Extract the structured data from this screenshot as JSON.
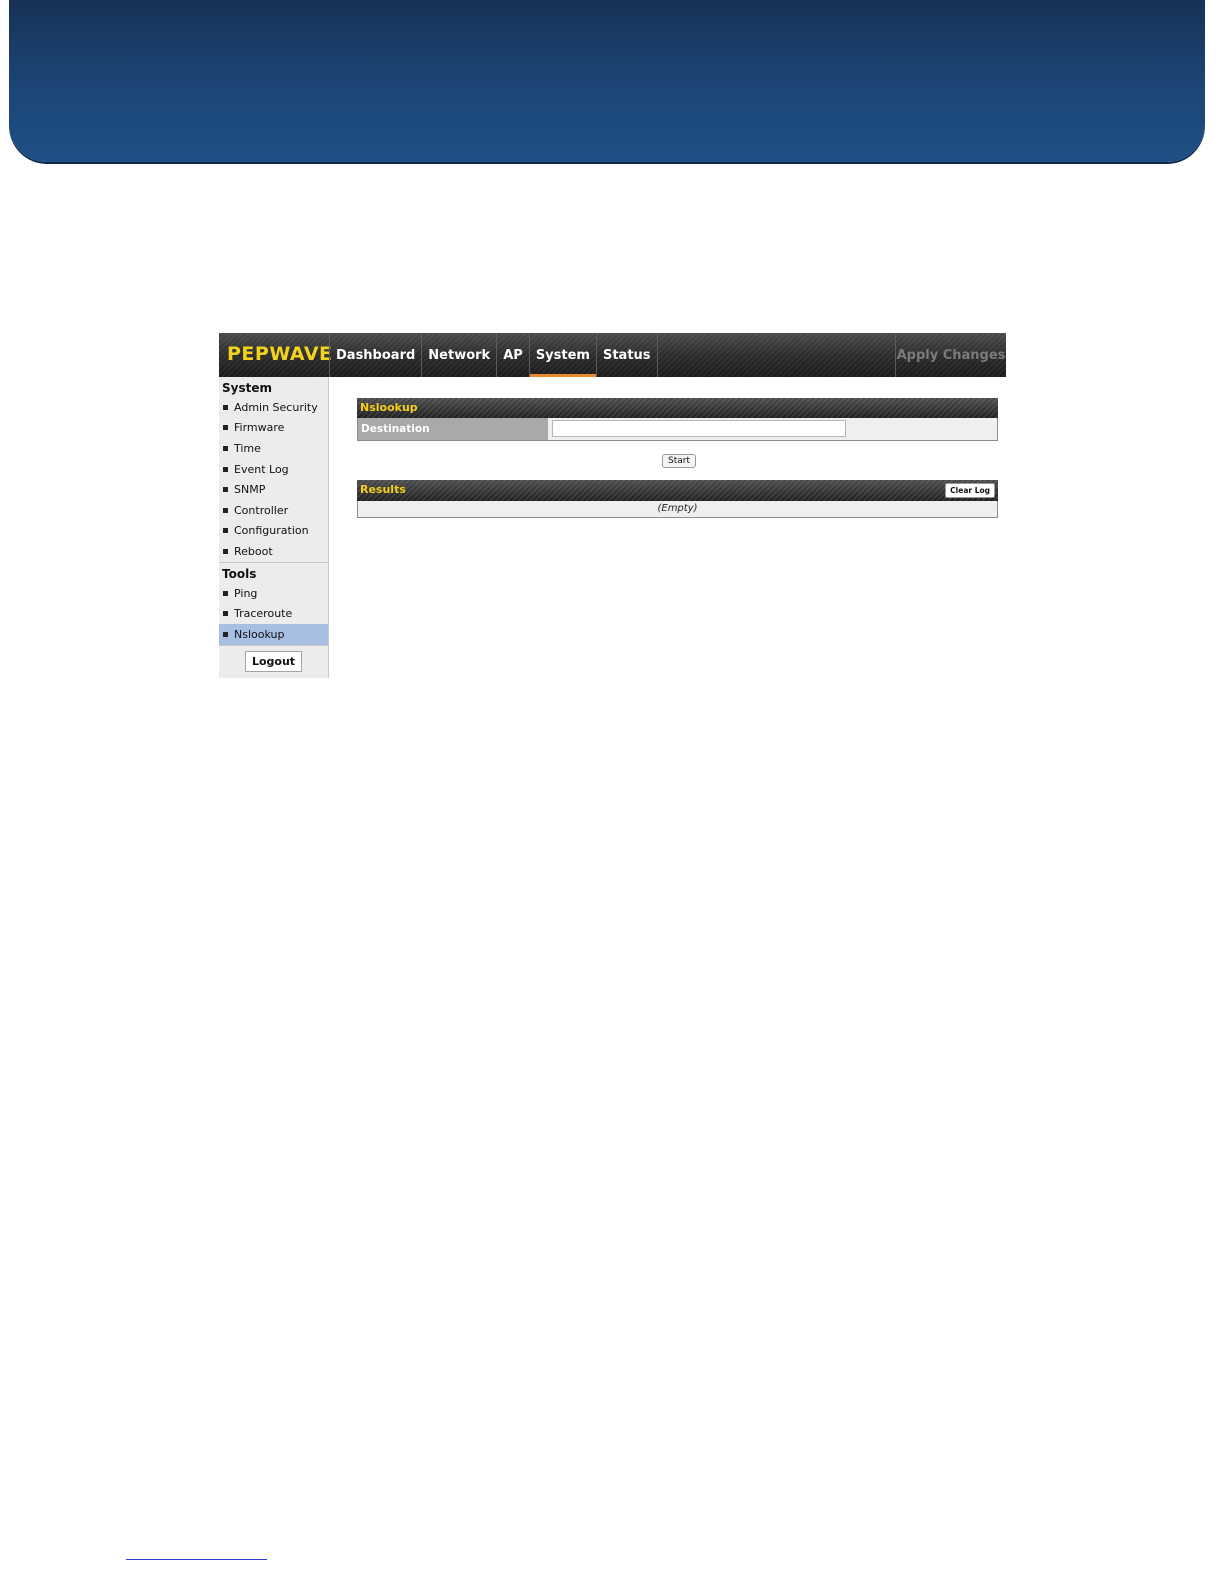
{
  "app": {
    "logo": "PEPWAVE",
    "nav": {
      "items": [
        {
          "label": "Dashboard"
        },
        {
          "label": "Network"
        },
        {
          "label": "AP"
        },
        {
          "label": "System",
          "active": true
        },
        {
          "label": "Status"
        }
      ],
      "apply_label": "Apply Changes"
    },
    "sidebar": {
      "system_heading": "System",
      "system_items": [
        "Admin Security",
        "Firmware",
        "Time",
        "Event Log",
        "SNMP",
        "Controller",
        "Configuration",
        "Reboot"
      ],
      "tools_heading": "Tools",
      "tools_items": [
        "Ping",
        "Traceroute",
        "Nslookup"
      ],
      "active_item": "Nslookup",
      "logout_label": "Logout"
    },
    "nslookup": {
      "title": "Nslookup",
      "destination_label": "Destination",
      "destination_value": "",
      "start_label": "Start"
    },
    "results": {
      "title": "Results",
      "clear_label": "Clear Log",
      "empty_text": "(Empty)"
    }
  },
  "colors": {
    "banner": "#1c4677",
    "accent_yellow": "#f2d21b",
    "active_tab_underline": "#e8892e",
    "active_sidebar": "#a6bfe3"
  }
}
